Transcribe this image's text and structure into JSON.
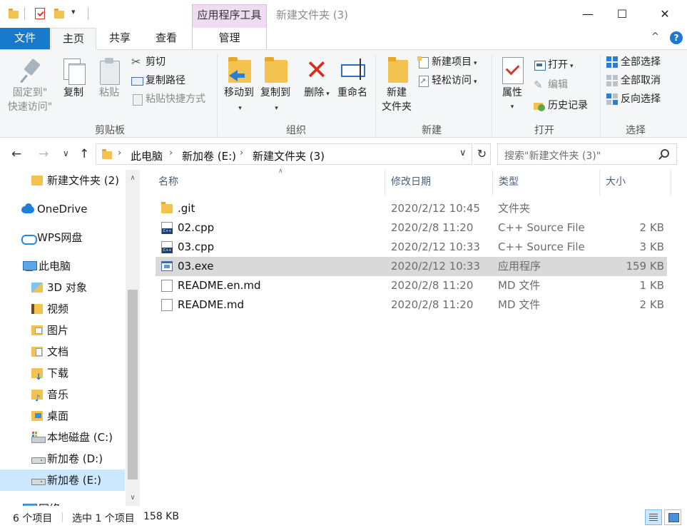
{
  "window": {
    "title": "新建文件夹 (3)",
    "context_tab_group": "应用程序工具",
    "min_glyph": "—",
    "max_glyph": "☐",
    "close_glyph": "✕"
  },
  "tabs": {
    "file": "文件",
    "home": "主页",
    "share": "共享",
    "view": "查看",
    "manage": "管理"
  },
  "ribbon": {
    "clipboard": {
      "label": "剪贴板",
      "pin_line1": "固定到\"",
      "pin_line2": "快速访问\"",
      "copy": "复制",
      "paste": "粘贴",
      "cut": "剪切",
      "copy_path": "复制路径",
      "paste_shortcut": "粘贴快捷方式"
    },
    "organize": {
      "label": "组织",
      "move_to": "移动到",
      "copy_to": "复制到",
      "delete": "删除",
      "rename": "重命名"
    },
    "new": {
      "label": "新建",
      "new_folder_line1": "新建",
      "new_folder_line2": "文件夹",
      "new_item": "新建项目",
      "easy_access": "轻松访问"
    },
    "open": {
      "label": "打开",
      "properties": "属性",
      "open": "打开",
      "edit": "编辑",
      "history": "历史记录"
    },
    "select": {
      "label": "选择",
      "select_all": "全部选择",
      "select_none": "全部取消",
      "invert": "反向选择"
    }
  },
  "address": {
    "crumbs": [
      "此电脑",
      "新加卷 (E:)",
      "新建文件夹 (3)"
    ],
    "search_placeholder": "搜索\"新建文件夹 (3)\""
  },
  "nav": {
    "items": [
      {
        "label": "新建文件夹 (2)",
        "icon": "folder-icon"
      },
      {
        "label": "OneDrive",
        "icon": "onedrive-cloud-icon"
      },
      {
        "label": "WPS网盘",
        "icon": "wps-cloud-icon"
      },
      {
        "label": "此电脑",
        "icon": "this-pc-icon"
      },
      {
        "label": "3D 对象",
        "icon": "3d-objects-icon"
      },
      {
        "label": "视频",
        "icon": "videos-icon"
      },
      {
        "label": "图片",
        "icon": "pictures-icon"
      },
      {
        "label": "文档",
        "icon": "documents-icon"
      },
      {
        "label": "下载",
        "icon": "downloads-icon"
      },
      {
        "label": "音乐",
        "icon": "music-icon"
      },
      {
        "label": "桌面",
        "icon": "desktop-icon"
      },
      {
        "label": "本地磁盘 (C:)",
        "icon": "system-drive-icon"
      },
      {
        "label": "新加卷 (D:)",
        "icon": "drive-icon"
      },
      {
        "label": "新加卷 (E:)",
        "icon": "drive-icon",
        "selected": true
      },
      {
        "label": "网络",
        "icon": "network-icon"
      }
    ]
  },
  "files": {
    "columns": {
      "name": "名称",
      "date": "修改日期",
      "type": "类型",
      "size": "大小"
    },
    "rows": [
      {
        "name": ".git",
        "date": "2020/2/12 10:45",
        "type": "文件夹",
        "size": "",
        "icon": "folder-icon"
      },
      {
        "name": "02.cpp",
        "date": "2020/2/8 11:20",
        "type": "C++ Source File",
        "size": "2 KB",
        "icon": "cpp-file-icon"
      },
      {
        "name": "03.cpp",
        "date": "2020/2/12 10:33",
        "type": "C++ Source File",
        "size": "3 KB",
        "icon": "cpp-file-icon"
      },
      {
        "name": "03.exe",
        "date": "2020/2/12 10:33",
        "type": "应用程序",
        "size": "159 KB",
        "icon": "exe-file-icon",
        "selected": true
      },
      {
        "name": "README.en.md",
        "date": "2020/2/8 11:20",
        "type": "MD 文件",
        "size": "1 KB",
        "icon": "md-file-icon"
      },
      {
        "name": "README.md",
        "date": "2020/2/8 11:20",
        "type": "MD 文件",
        "size": "2 KB",
        "icon": "md-file-icon"
      }
    ]
  },
  "status": {
    "item_count": "6 个项目",
    "selection": "选中 1 个项目",
    "selection_size": "158 KB"
  },
  "colors": {
    "file_tab": "#1979ca",
    "context_tab": "#f0dcf2",
    "selected_nav": "#cce8ff",
    "selected_row": "#d9d9d9",
    "folder": "#f3c24f"
  }
}
